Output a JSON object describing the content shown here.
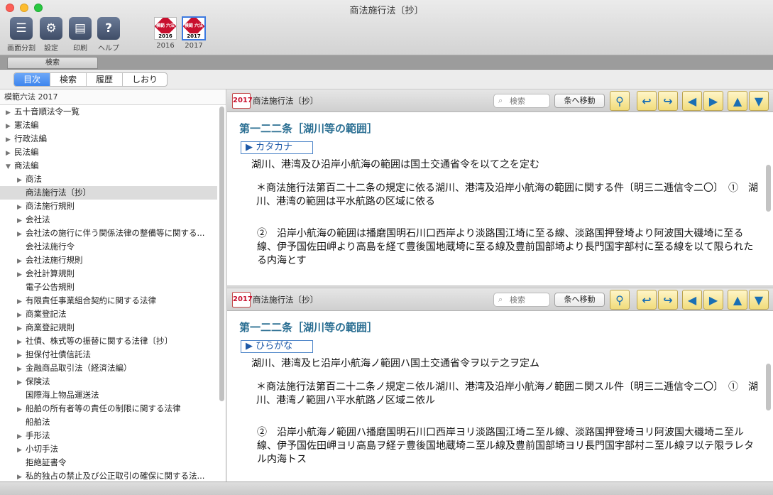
{
  "window": {
    "title": "商法施行法〔抄〕"
  },
  "toolbar": {
    "buttons": [
      {
        "label": "画面分割",
        "icon": "split-screen-icon"
      },
      {
        "label": "設定",
        "icon": "gear-icon"
      },
      {
        "label": "印刷",
        "icon": "printer-icon"
      },
      {
        "label": "ヘルプ",
        "icon": "help-icon"
      }
    ],
    "books": [
      {
        "year": "2016",
        "badge_text": "模範 六法"
      },
      {
        "year": "2017",
        "badge_text": "模範 六法"
      }
    ]
  },
  "search_strip": {
    "tab_label": "検索"
  },
  "segments": [
    "目次",
    "検索",
    "履歴",
    "しおり"
  ],
  "sidebar": {
    "header": "模範六法 2017",
    "items": [
      {
        "label": "五十音順法令一覧",
        "level": 0,
        "arrow": "▶"
      },
      {
        "label": "憲法編",
        "level": 0,
        "arrow": "▶"
      },
      {
        "label": "行政法編",
        "level": 0,
        "arrow": "▶"
      },
      {
        "label": "民法編",
        "level": 0,
        "arrow": "▶"
      },
      {
        "label": "商法編",
        "level": 0,
        "arrow": "▼"
      },
      {
        "label": "商法",
        "level": 1,
        "arrow": "▶"
      },
      {
        "label": "商法施行法〔抄〕",
        "level": 1,
        "arrow": "",
        "selected": true
      },
      {
        "label": "商法施行規則",
        "level": 1,
        "arrow": "▶"
      },
      {
        "label": "会社法",
        "level": 1,
        "arrow": "▶"
      },
      {
        "label": "会社法の施行に伴う関係法律の整備等に関する...",
        "level": 1,
        "arrow": "▶"
      },
      {
        "label": "会社法施行令",
        "level": 1,
        "arrow": ""
      },
      {
        "label": "会社法施行規則",
        "level": 1,
        "arrow": "▶"
      },
      {
        "label": "会社計算規則",
        "level": 1,
        "arrow": "▶"
      },
      {
        "label": "電子公告規則",
        "level": 1,
        "arrow": ""
      },
      {
        "label": "有限責任事業組合契約に関する法律",
        "level": 1,
        "arrow": "▶"
      },
      {
        "label": "商業登記法",
        "level": 1,
        "arrow": "▶"
      },
      {
        "label": "商業登記規則",
        "level": 1,
        "arrow": "▶"
      },
      {
        "label": "社債、株式等の振替に関する法律〔抄〕",
        "level": 1,
        "arrow": "▶"
      },
      {
        "label": "担保付社債信託法",
        "level": 1,
        "arrow": "▶"
      },
      {
        "label": "金融商品取引法（経済法編）",
        "level": 1,
        "arrow": "▶"
      },
      {
        "label": "保険法",
        "level": 1,
        "arrow": "▶"
      },
      {
        "label": "国際海上物品運送法",
        "level": 1,
        "arrow": ""
      },
      {
        "label": "船舶の所有者等の責任の制限に関する法律",
        "level": 1,
        "arrow": "▶"
      },
      {
        "label": "船舶法",
        "level": 1,
        "arrow": ""
      },
      {
        "label": "手形法",
        "level": 1,
        "arrow": "▶"
      },
      {
        "label": "小切手法",
        "level": 1,
        "arrow": "▶"
      },
      {
        "label": "拒絶証書令",
        "level": 1,
        "arrow": ""
      },
      {
        "label": "私的独占の禁止及び公正取引の確保に関する法...",
        "level": 1,
        "arrow": "▶"
      }
    ]
  },
  "panes": [
    {
      "year": "2017",
      "title": "商法施行法〔抄〕",
      "search_placeholder": "検索",
      "goto_label": "条へ移動",
      "article_heading": "第一二二条［湖川等の範囲］",
      "mode": "▶ カタカナ",
      "text1": "湖川、港湾及ひ沿岸小航海の範囲は国土交通省令を以て之を定む",
      "text2": "＊商法施行法第百二十二条の規定に依る湖川、港湾及沿岸小航海の範囲に関する件〔明三二逓信令二〇〕　①　湖川、港湾の範囲は平水航路の区域に依る",
      "text3": "②　沿岸小航海の範囲は播磨国明石川口西岸より淡路国江埼に至る線、淡路国押登埼より阿波国大磯埼に至る線、伊予国佐田岬より高島を経て豊後国地蔵埼に至る線及豊前国部埼より長門国宇部村に至る線を以て限られたる内海とす"
    },
    {
      "year": "2017",
      "title": "商法施行法〔抄〕",
      "search_placeholder": "検索",
      "goto_label": "条へ移動",
      "article_heading": "第一二二条［湖川等の範囲］",
      "mode": "▶ ひらがな",
      "text1": "湖川、港湾及ヒ沿岸小航海ノ範囲ハ国土交通省令ヲ以テ之ヲ定ム",
      "text2": "＊商法施行法第百二十二条ノ規定ニ依ル湖川、港湾及沿岸小航海ノ範囲ニ関スル件〔明三二逓信令二〇〕　①　湖川、港湾ノ範囲ハ平水航路ノ区域ニ依ル",
      "text3": "②　沿岸小航海ノ範囲ハ播磨国明石川口西岸ヨリ淡路国江埼ニ至ル線、淡路国押登埼ヨリ阿波国大磯埼ニ至ル線、伊予国佐田岬ヨリ高島ヲ経テ豊後国地蔵埼ニ至ル線及豊前国部埼ヨリ長門国宇部村ニ至ル線ヲ以テ限ラレタル内海トス"
    }
  ],
  "nav_icons": [
    "zoom-icon",
    "back-icon",
    "forward-icon",
    "previous-article-icon",
    "next-article-icon",
    "scroll-up-icon",
    "scroll-down-icon"
  ],
  "colors": {
    "accent": "#3d85ee",
    "heading": "#2b6f93",
    "badge_red": "#c8102e",
    "nav_button": "#f1dc7b"
  }
}
